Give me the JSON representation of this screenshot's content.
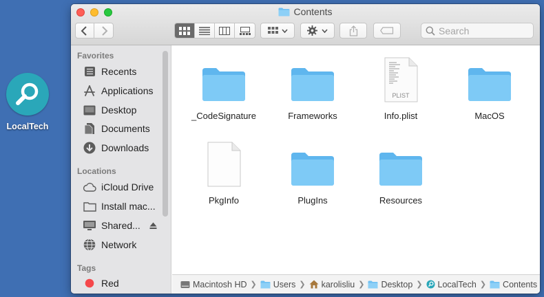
{
  "desktop": {
    "app_label": "LocalTech",
    "app_icon": "magnifier-icon",
    "app_color": "#2aa7b9"
  },
  "window": {
    "title": "Contents",
    "search_placeholder": "Search"
  },
  "sidebar": {
    "favorites_heading": "Favorites",
    "favorites": [
      {
        "label": "Recents",
        "icon": "clock-icon"
      },
      {
        "label": "Applications",
        "icon": "applications-icon"
      },
      {
        "label": "Desktop",
        "icon": "desktop-icon"
      },
      {
        "label": "Documents",
        "icon": "document-icon"
      },
      {
        "label": "Downloads",
        "icon": "download-icon"
      }
    ],
    "locations_heading": "Locations",
    "locations": [
      {
        "label": "iCloud Drive",
        "icon": "cloud-icon"
      },
      {
        "label": "Install mac...",
        "icon": "drive-icon"
      },
      {
        "label": "Shared...",
        "icon": "monitor-icon"
      },
      {
        "label": "Network",
        "icon": "globe-icon"
      }
    ],
    "tags_heading": "Tags",
    "tags": [
      {
        "label": "Red",
        "color": "#f5484b"
      }
    ]
  },
  "files": [
    {
      "name": "_CodeSignature",
      "kind": "folder"
    },
    {
      "name": "Frameworks",
      "kind": "folder"
    },
    {
      "name": "Info.plist",
      "kind": "plist",
      "badge": "PLIST"
    },
    {
      "name": "MacOS",
      "kind": "folder"
    },
    {
      "name": "PkgInfo",
      "kind": "document"
    },
    {
      "name": "PlugIns",
      "kind": "folder"
    },
    {
      "name": "Resources",
      "kind": "folder"
    }
  ],
  "pathbar": [
    {
      "label": "Macintosh HD",
      "icon": "hard-drive-icon"
    },
    {
      "label": "Users",
      "icon": "folder-icon"
    },
    {
      "label": "karolisliu",
      "icon": "home-icon"
    },
    {
      "label": "Desktop",
      "icon": "folder-icon"
    },
    {
      "label": "LocalTech",
      "icon": "app-icon"
    },
    {
      "label": "Contents",
      "icon": "folder-icon"
    }
  ],
  "colors": {
    "folder": "#6fc0f2",
    "desktop_bg": "#3f6fb3"
  }
}
